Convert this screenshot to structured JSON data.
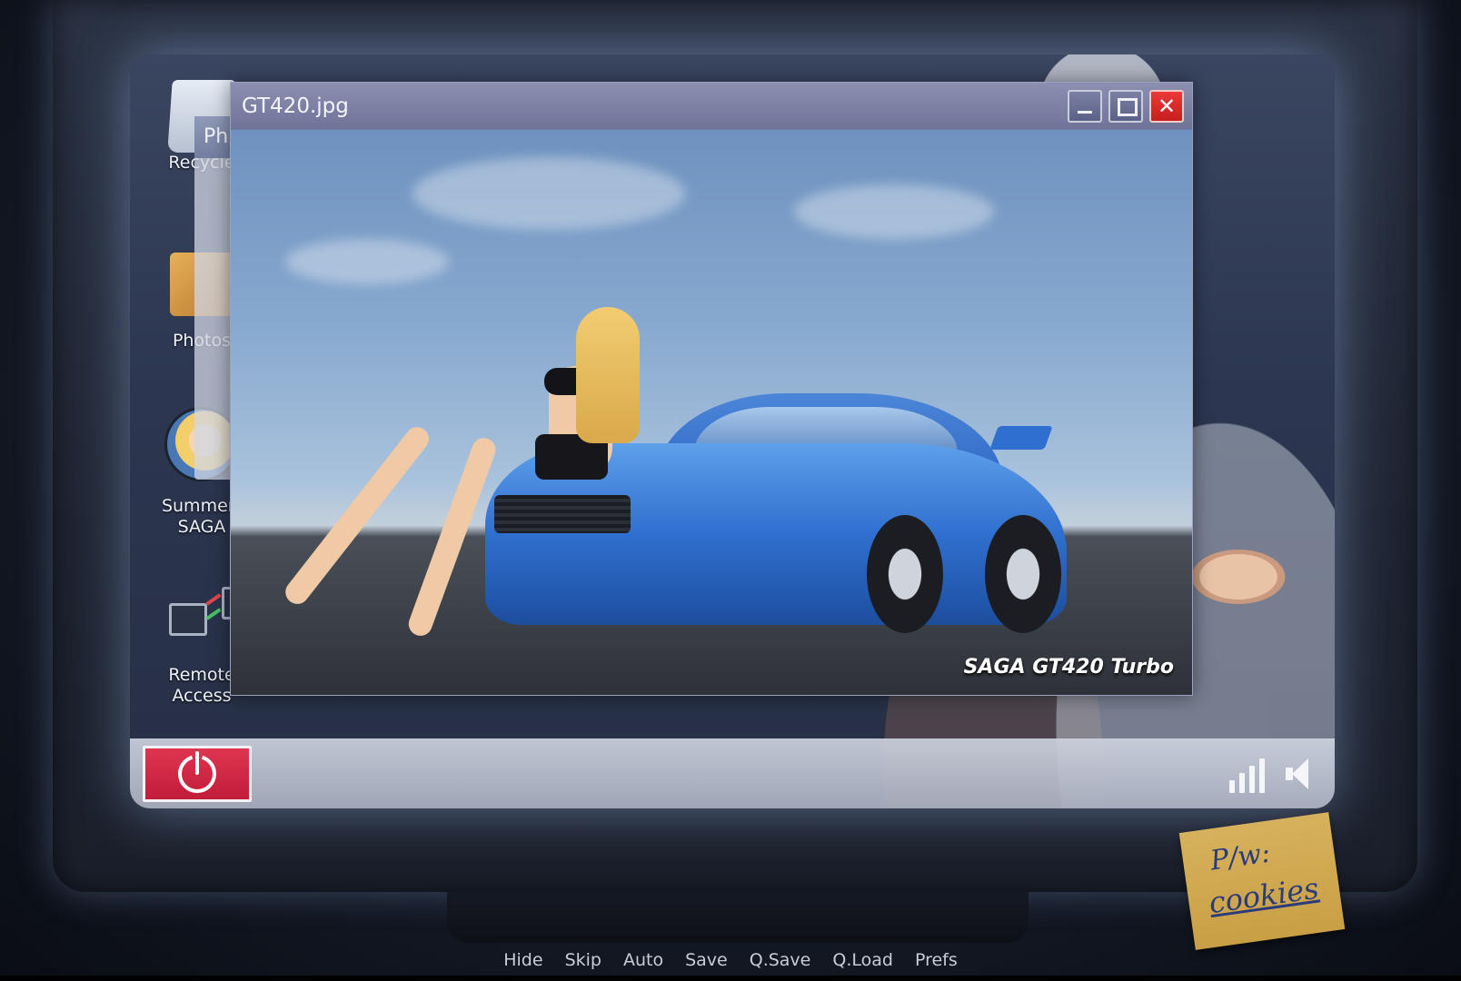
{
  "window": {
    "title": "GT420.jpg",
    "close_glyph": "✕"
  },
  "background_window": {
    "title": "Ph"
  },
  "desktop": {
    "icons": [
      {
        "label": "Recycle",
        "icon": "recycle-bin-icon"
      },
      {
        "label": "Photos",
        "icon": "photos-folder-icon"
      },
      {
        "label": "Summert SAGA",
        "line1": "Summert",
        "line2": "SAGA",
        "icon": "summertime-saga-icon"
      },
      {
        "label": "Remote Access",
        "line1": "Remote",
        "line2": "Access",
        "icon": "remote-access-icon"
      }
    ]
  },
  "photo": {
    "caption": "SAGA GT420 Turbo"
  },
  "taskbar": {
    "power_icon": "power-icon",
    "signal_icon": "signal-bars-icon",
    "volume_icon": "speaker-icon"
  },
  "sticky_note": {
    "line1": "P/w:",
    "line2": "cookies"
  },
  "quick_menu": {
    "items": [
      "Hide",
      "Skip",
      "Auto",
      "Save",
      "Q.Save",
      "Q.Load",
      "Prefs"
    ]
  },
  "colors": {
    "power_button": "#c11c38",
    "close_button": "#c71e1e",
    "car_blue": "#2f6fcf",
    "sticky_note": "#d7b15c"
  }
}
